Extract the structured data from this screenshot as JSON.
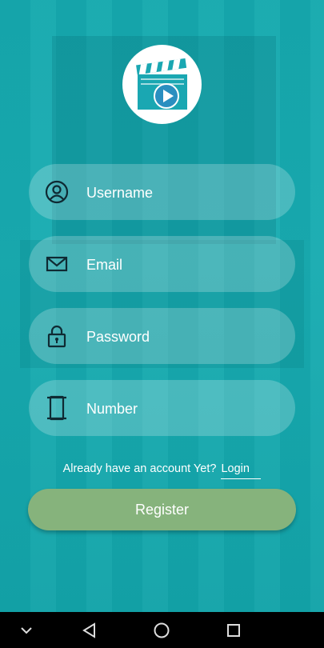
{
  "logo": {
    "icon": "film-clapper-play-icon"
  },
  "form": {
    "username": {
      "placeholder": "Username",
      "icon": "user-circle-icon"
    },
    "email": {
      "placeholder": "Email",
      "icon": "envelope-icon"
    },
    "password": {
      "placeholder": "Password",
      "icon": "lock-icon"
    },
    "number": {
      "placeholder": "Number",
      "icon": "phone-icon"
    }
  },
  "account": {
    "prompt": "Already have an account Yet?",
    "login_label": "Login"
  },
  "register_label": "Register",
  "navbar": {
    "items": [
      "chevron-down-icon",
      "back-icon",
      "home-icon",
      "recents-icon"
    ]
  },
  "colors": {
    "background": "#19a8ad",
    "button": "#86b37c",
    "accent": "#1aa7b2"
  }
}
